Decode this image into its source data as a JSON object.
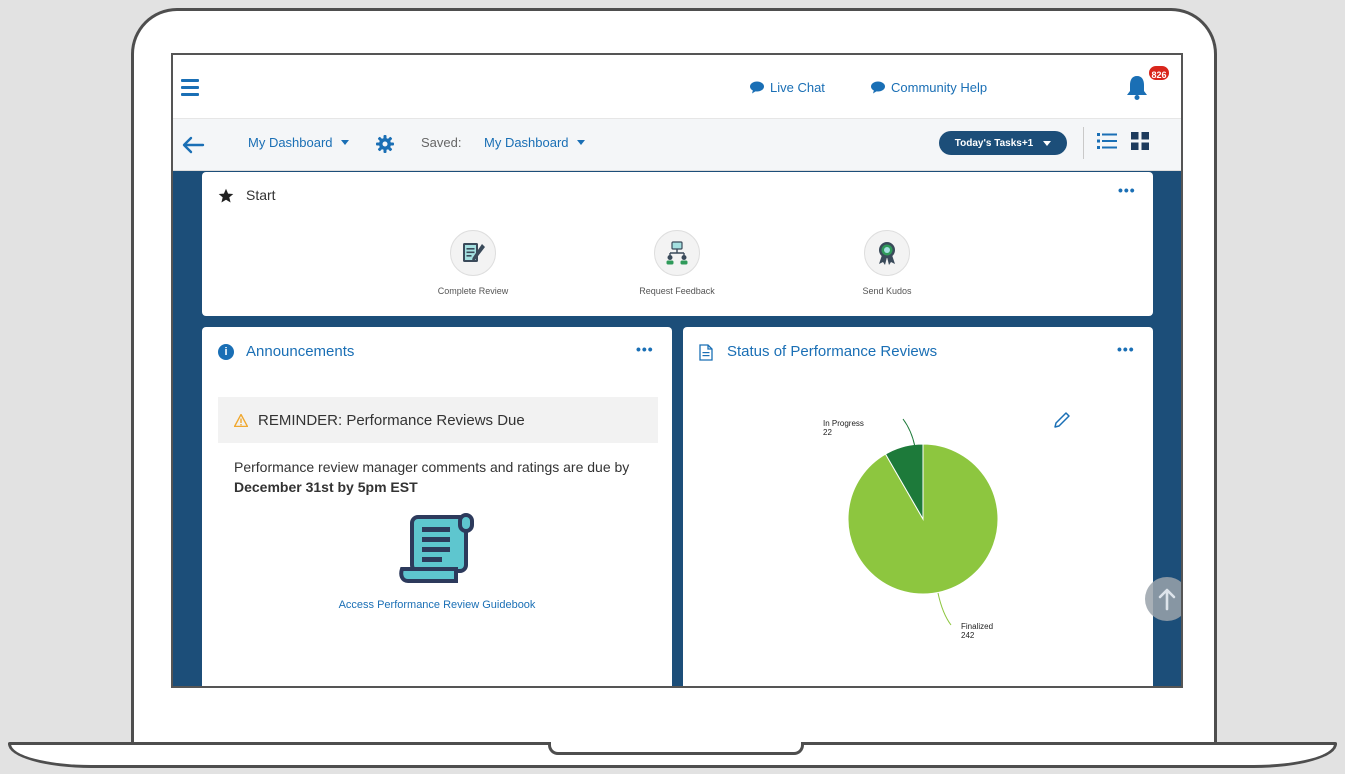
{
  "topbar": {
    "live_chat": "Live Chat",
    "community_help": "Community Help",
    "notification_count": "826"
  },
  "subbar": {
    "dashboard_label": "My Dashboard",
    "saved_label": "Saved:",
    "saved_value": "My Dashboard",
    "tasks_button": "Today's Tasks+1"
  },
  "start": {
    "title": "Start",
    "items": [
      {
        "label": "Complete Review",
        "icon": "review-icon"
      },
      {
        "label": "Request Feedback",
        "icon": "feedback-icon"
      },
      {
        "label": "Send Kudos",
        "icon": "award-icon"
      }
    ]
  },
  "announcements": {
    "title": "Announcements",
    "reminder": "REMINDER: Performance Reviews Due",
    "body_text": "Performance review manager comments and ratings are due by ",
    "body_bold": "December 31st by 5pm EST",
    "link": "Access Performance Review Guidebook"
  },
  "status": {
    "title": "Status of Performance Reviews"
  },
  "chart_data": {
    "type": "pie",
    "title": "Status of Performance Reviews",
    "slices": [
      {
        "label": "In Progress",
        "value": 22,
        "color": "#1d7a3a"
      },
      {
        "label": "Finalized",
        "value": 242,
        "color": "#8dc63f"
      }
    ]
  },
  "colors": {
    "accent": "#1a6fb5",
    "dashboard_bg": "#1c4e79",
    "badge": "#d9261c"
  }
}
